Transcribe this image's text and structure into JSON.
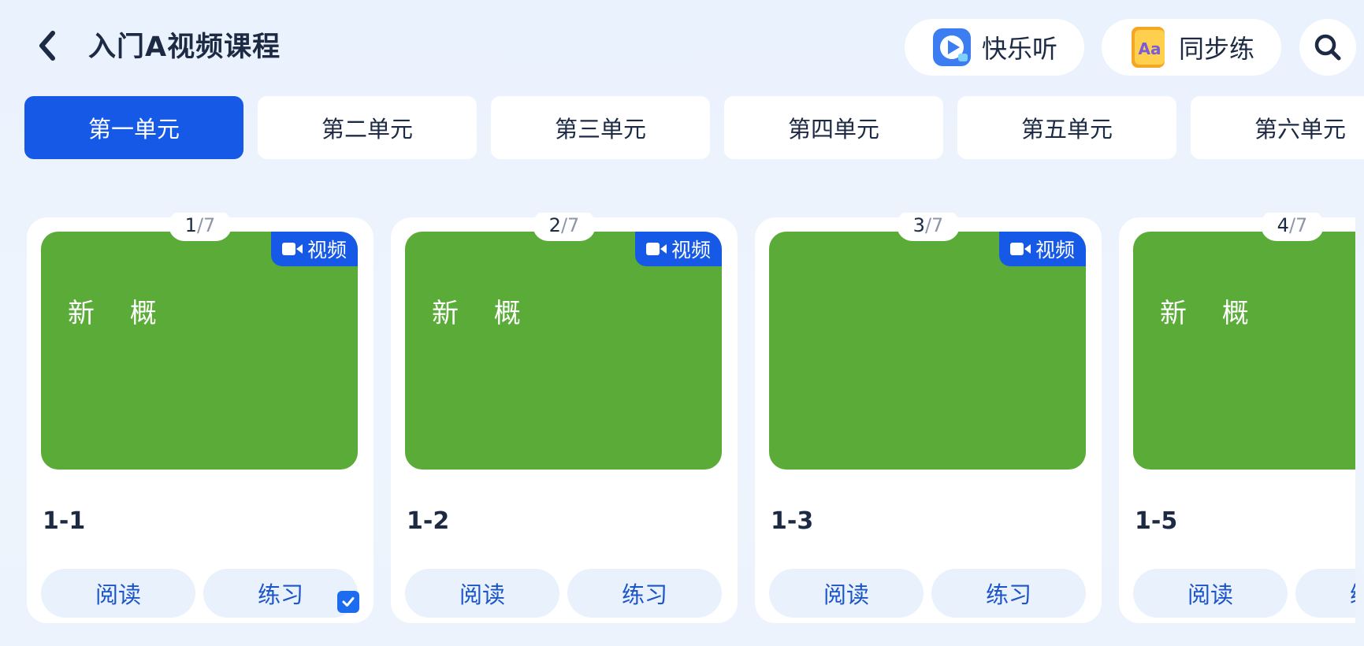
{
  "header": {
    "title": "入门A视频课程",
    "listen_label": "快乐听",
    "practice_label": "同步练",
    "practice_icon_text": "Aa"
  },
  "tabs": [
    {
      "label": "第一单元",
      "active": true
    },
    {
      "label": "第二单元",
      "active": false
    },
    {
      "label": "第三单元",
      "active": false
    },
    {
      "label": "第四单元",
      "active": false
    },
    {
      "label": "第五单元",
      "active": false
    },
    {
      "label": "第六单元",
      "active": false
    }
  ],
  "cards": [
    {
      "index": "1",
      "total": "/7",
      "badge": "视频",
      "thumb_text": "新 概",
      "title": "1-1",
      "read": "阅读",
      "practice": "练习",
      "completed": true
    },
    {
      "index": "2",
      "total": "/7",
      "badge": "视频",
      "thumb_text": "新 概",
      "title": "1-2",
      "read": "阅读",
      "practice": "练习",
      "completed": false
    },
    {
      "index": "3",
      "total": "/7",
      "badge": "视频",
      "thumb_text": "",
      "title": "1-3",
      "read": "阅读",
      "practice": "练习",
      "completed": false
    },
    {
      "index": "4",
      "total": "/7",
      "badge": "",
      "thumb_text": "新 概",
      "title": "1-5",
      "read": "阅读",
      "practice": "练习",
      "completed": false
    }
  ],
  "colors": {
    "accent": "#1559e6",
    "thumb_green": "#5aab38",
    "button_bg": "#e9f1fc"
  },
  "icons": {
    "back": "chevron-left-icon",
    "listen": "play-icon",
    "practice": "aa-book-icon",
    "search": "search-icon",
    "video": "video-camera-icon",
    "check": "checkmark-icon"
  }
}
